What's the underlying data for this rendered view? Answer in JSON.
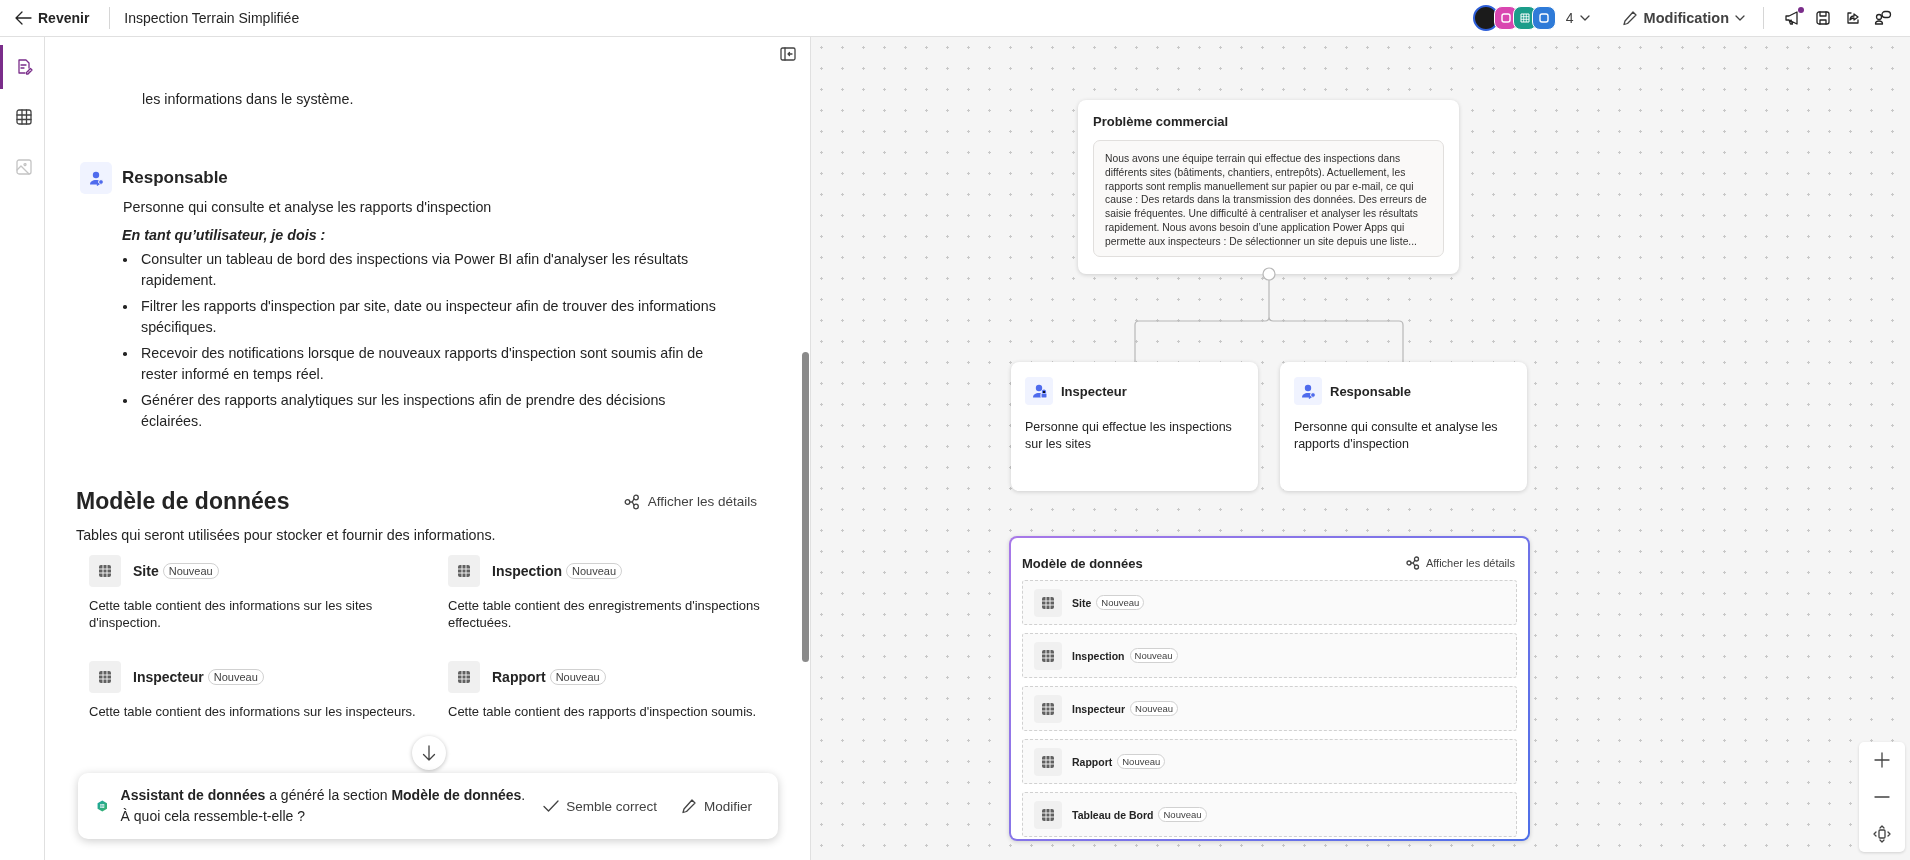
{
  "top_bar": {
    "back_label": "Revenir",
    "title": "Inspection Terrain Simplifiée",
    "collaborator_count": "4",
    "mode_label": "Modification",
    "notification": true
  },
  "rail": [
    {
      "kind": "requirements",
      "selected": true,
      "disabled": false
    },
    {
      "kind": "table",
      "selected": false,
      "disabled": false
    },
    {
      "kind": "image",
      "selected": false,
      "disabled": true
    }
  ],
  "panel": {
    "previous_bullet_end": "les informations dans le système.",
    "persona": {
      "kind": "manager",
      "name": "Responsable",
      "description": "Personne qui consulte et analyse les rapports d'inspection",
      "lead": "En tant qu’utilisateur, je dois :",
      "needs": [
        "Consulter un tableau de bord des inspections via Power BI afin d'analyser les résultats rapidement.",
        "Filtrer les rapports d'inspection par site, date ou inspecteur afin de trouver des informations spécifiques.",
        "Recevoir des notifications lorsque de nouveaux rapports d'inspection sont soumis afin de rester informé en temps réel.",
        "Générer des rapports analytiques sur les inspections afin de prendre des décisions éclairées."
      ]
    },
    "data_model": {
      "title": "Modèle de données",
      "details_label": "Afficher les détails",
      "description": "Tables qui seront utilisées pour stocker et fournir des informations.",
      "tables": [
        {
          "name": "Site",
          "badge": "Nouveau",
          "description": "Cette table contient des informations sur les sites d'inspection."
        },
        {
          "name": "Inspection",
          "badge": "Nouveau",
          "description": "Cette table contient des enregistrements d'inspections effectuées."
        },
        {
          "name": "Inspecteur",
          "badge": "Nouveau",
          "description": "Cette table contient des informations sur les inspecteurs."
        },
        {
          "name": "Rapport",
          "badge": "Nouveau",
          "description": "Cette table contient des rapports d'inspection soumis."
        }
      ]
    }
  },
  "toast": {
    "message": "**Assistant de données** a généré la section **Modèle de données**.",
    "question": "À quoi cela ressemble-t-elle ?",
    "confirm_label": "Semble correct",
    "edit_label": "Modifier"
  },
  "canvas": {
    "problem": {
      "title": "Problème commercial",
      "text": "Nous avons une équipe terrain qui effectue des inspections dans différents sites (bâtiments, chantiers, entrepôts). Actuellement, les rapports sont remplis manuellement sur papier ou par e-mail, ce qui cause : Des retards dans la transmission des données. Des erreurs de saisie fréquentes. Une difficulté à centraliser et analyser les résultats rapidement. Nous avons besoin d’une application Power Apps qui permette aux inspecteurs : De sélectionner un site depuis une liste..."
    },
    "personas": [
      {
        "kind": "worker",
        "name": "Inspecteur",
        "description": "Personne qui effectue les inspections sur les sites"
      },
      {
        "kind": "manager",
        "name": "Responsable",
        "description": "Personne qui consulte et analyse les rapports d'inspection"
      }
    ],
    "data_model": {
      "title": "Modèle de données",
      "details_label": "Afficher les détails",
      "selected": true,
      "tables": [
        {
          "name": "Site",
          "badge": "Nouveau"
        },
        {
          "name": "Inspection",
          "badge": "Nouveau"
        },
        {
          "name": "Inspecteur",
          "badge": "Nouveau"
        },
        {
          "name": "Rapport",
          "badge": "Nouveau"
        },
        {
          "name": "Tableau de Bord",
          "badge": "Nouveau"
        }
      ]
    }
  }
}
